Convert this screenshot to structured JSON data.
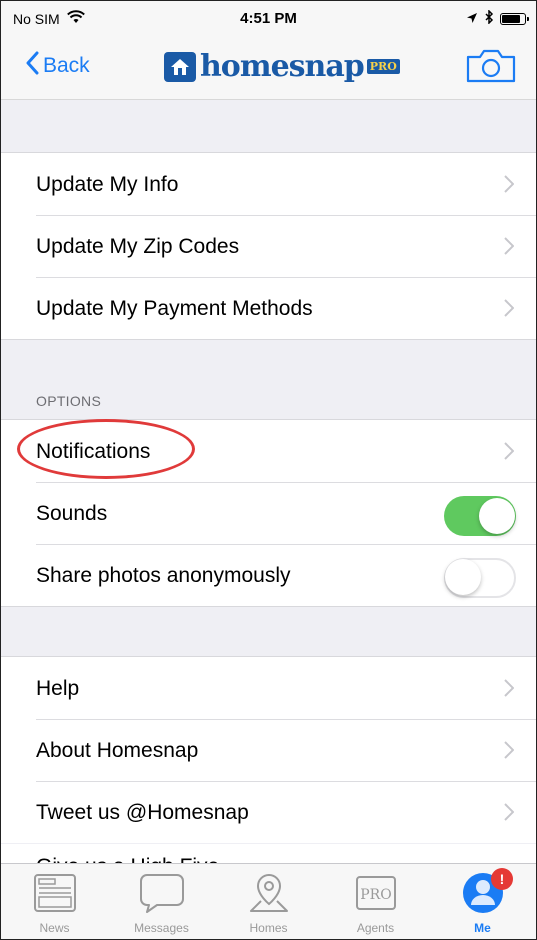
{
  "status_bar": {
    "carrier": "No SIM",
    "time": "4:51 PM"
  },
  "nav": {
    "back_label": "Back",
    "logo_word": "homesnap",
    "logo_badge": "PRO",
    "camera_icon": "camera-icon"
  },
  "account_rows": [
    {
      "label": "Update My Info"
    },
    {
      "label": "Update My Zip Codes"
    },
    {
      "label": "Update My Payment Methods"
    }
  ],
  "options": {
    "header": "OPTIONS",
    "notifications": "Notifications",
    "sounds": {
      "label": "Sounds",
      "on": true
    },
    "share": {
      "label": "Share photos anonymously",
      "on": false
    }
  },
  "info_rows": [
    {
      "label": "Help"
    },
    {
      "label": "About Homesnap"
    },
    {
      "label": "Tweet us @Homesnap"
    }
  ],
  "partial_row": {
    "label": "Give us a High Five"
  },
  "tabs": [
    {
      "label": "News",
      "icon": "newspaper-icon"
    },
    {
      "label": "Messages",
      "icon": "chat-bubble-icon"
    },
    {
      "label": "Homes",
      "icon": "map-pin-icon"
    },
    {
      "label": "Agents",
      "icon": "pro-badge-icon",
      "icon_text": "PRO"
    },
    {
      "label": "Me",
      "icon": "person-icon",
      "badge": "!"
    }
  ],
  "colors": {
    "accent": "#1b7cf4",
    "brand": "#1a5aa6",
    "toggle_on": "#5fc95f",
    "annotation": "#e03a3a",
    "badge": "#e53935"
  }
}
